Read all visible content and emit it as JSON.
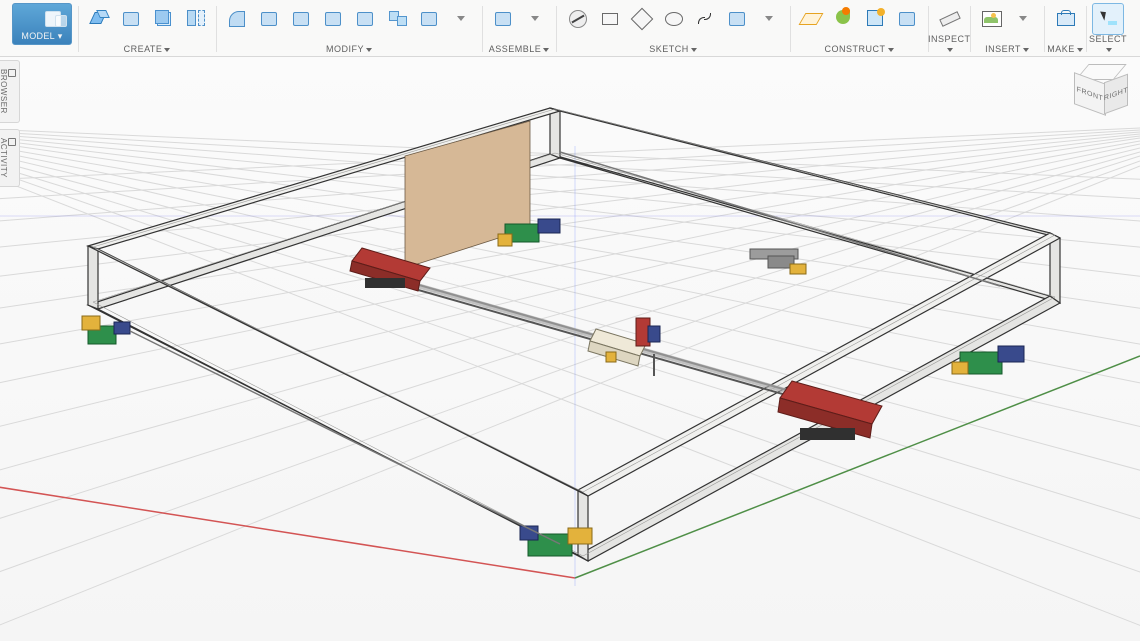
{
  "toolbar": {
    "model_button": "MODEL",
    "groups": {
      "create": "CREATE",
      "modify": "MODIFY",
      "assemble": "ASSEMBLE",
      "sketch": "SKETCH",
      "construct": "CONSTRUCT",
      "inspect": "INSPECT",
      "insert": "INSERT",
      "make": "MAKE",
      "select": "SELECT"
    }
  },
  "side": {
    "browser": "BROWSER",
    "activity": "ACTIVITY"
  },
  "viewcube": {
    "front": "FRONT",
    "right": "RIGHT"
  }
}
